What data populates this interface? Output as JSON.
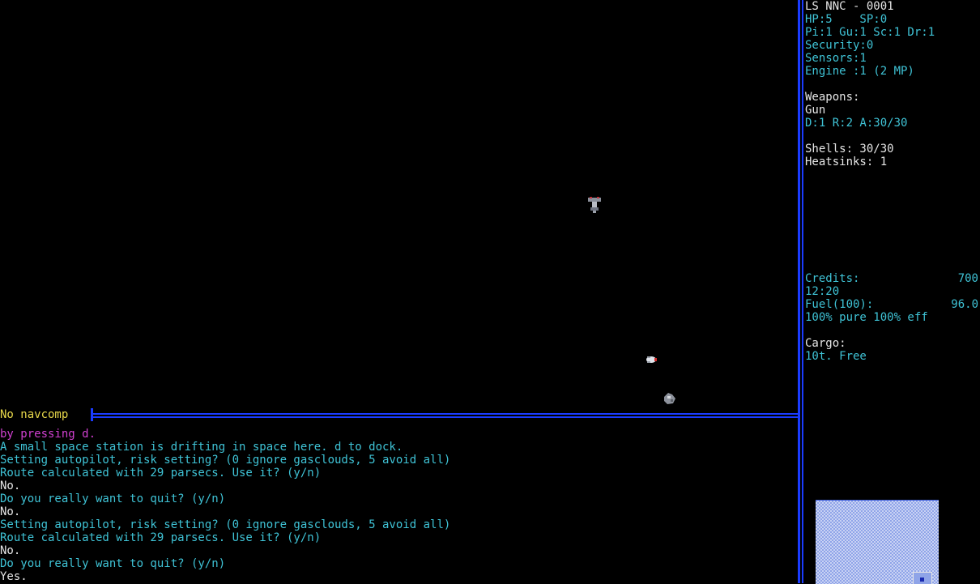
{
  "status": {
    "ship_name": "LS NNC - 0001",
    "hp_sp": "HP:5    SP:0",
    "skills": "Pi:1 Gu:1 Sc:1 Dr:1",
    "security": "Security:0",
    "sensors": "Sensors:1",
    "engine": "Engine :1 (2 MP)",
    "weapons_label": "Weapons:",
    "weapon_name": "Gun",
    "weapon_stats": "D:1 R:2 A:30/30",
    "shells": "Shells: 30/30",
    "heatsinks": "Heatsinks: 1",
    "credits_label": "Credits:",
    "credits_value": "700",
    "time": "12:20",
    "fuel_label": "Fuel(100):",
    "fuel_value": "96.0",
    "fuel_quality": "100% pure 100% eff",
    "cargo_label": "Cargo:",
    "cargo_free": "10t. Free"
  },
  "navcomp": "No navcomp",
  "log": [
    "by pressing d.",
    "A small space station is drifting in space here. d to dock.",
    "Setting autopilot, risk setting? (0 ignore gasclouds, 5 avoid all)",
    "Route calculated with 29 parsecs. Use it? (y/n)",
    "No.",
    "Do you really want to quit? (y/n)",
    "No.",
    "Setting autopilot, risk setting? (0 ignore gasclouds, 5 avoid all)",
    "Route calculated with 29 parsecs. Use it? (y/n)",
    "No.",
    "Do you really want to quit? (y/n)",
    "Yes."
  ],
  "sprites": [
    "space-station-icon",
    "player-ship-icon",
    "asteroid-icon"
  ],
  "colors": {
    "background": "#000000",
    "text_cyan": "#3fc3d6",
    "text_white": "#e6e6e6",
    "text_yellow": "#e8d84a",
    "text_magenta": "#d040d0",
    "divider_blue": "#1a3cff"
  }
}
